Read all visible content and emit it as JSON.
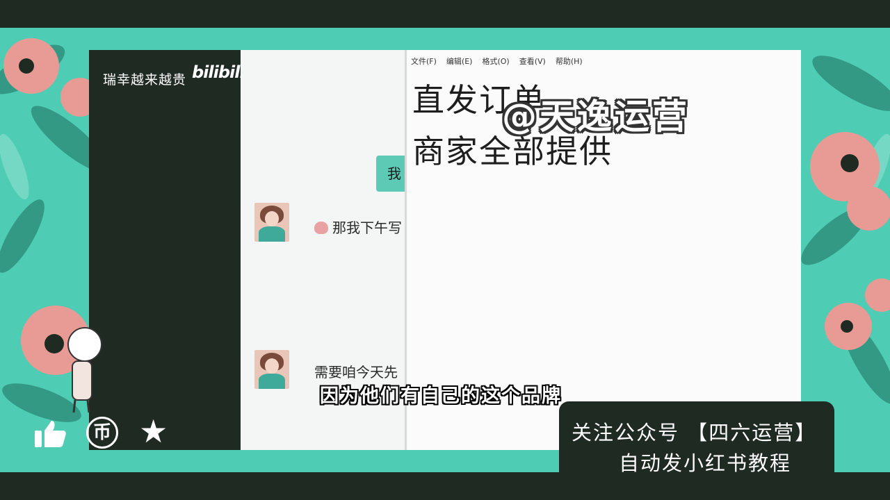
{
  "overlay": {
    "channel_title": "瑞幸越来越贵",
    "platform_logo": "bilibili",
    "subtitle": "因为他们有自己的这个品牌",
    "watermark": "@天逸运营"
  },
  "chat": {
    "self_bubble": "我",
    "messages": [
      {
        "text": "那我下午写"
      },
      {
        "text": "需要咱今天先"
      }
    ]
  },
  "notepad": {
    "menu": [
      "文件(F)",
      "编辑(E)",
      "格式(O)",
      "查看(V)",
      "帮助(H)"
    ],
    "lines": [
      "直发订单",
      "商家全部提供"
    ]
  },
  "promo": {
    "line1": "关注公众号 【四六运营】",
    "line2": "自动发小红书教程"
  },
  "actions": {
    "like_icon": "thumbs-up-icon",
    "coin_icon": "coin-icon",
    "star_icon": "star-icon"
  },
  "colors": {
    "teal_background": "#4ecdb4",
    "dark_panel": "#1f2a22",
    "flower_pink": "#e89a94"
  }
}
